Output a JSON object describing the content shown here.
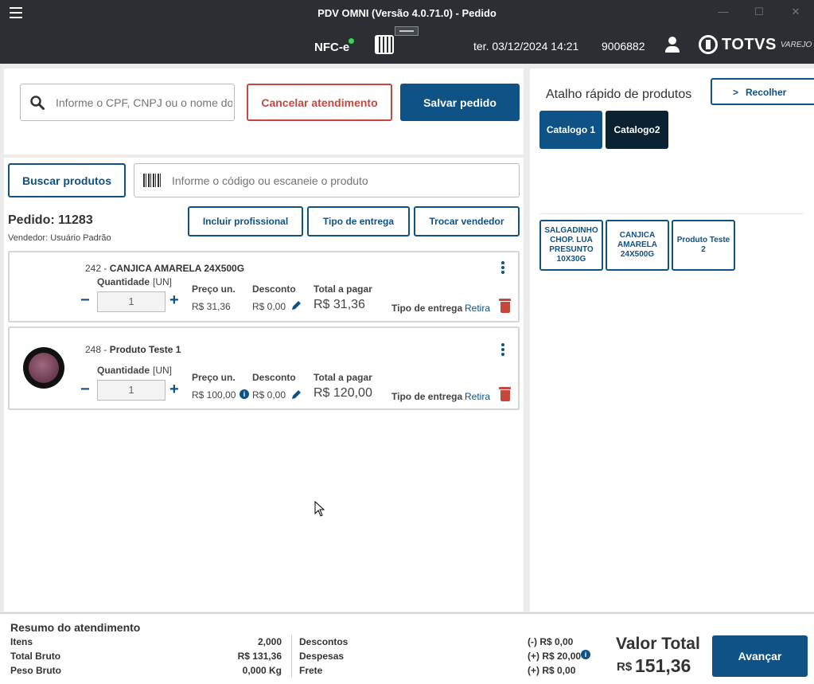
{
  "window": {
    "title": "PDV OMNI (Versão 4.0.71.0) - Pedido"
  },
  "header": {
    "nfce_label": "NFC-e",
    "datetime": "ter. 03/12/2024 14:21",
    "code": "9006882",
    "brand": "TOTVS",
    "brand_sub": "VAREJO"
  },
  "customer": {
    "search_placeholder": "Informe o CPF, CNPJ ou o nome do cliente",
    "cancel_label": "Cancelar atendimento",
    "save_label": "Salvar pedido"
  },
  "products": {
    "search_button": "Buscar produtos",
    "barcode_placeholder": "Informe o código ou escaneie o produto"
  },
  "order": {
    "title": "Pedido: 11283",
    "seller": "Vendedor: Usuário Padrão",
    "actions": [
      "Incluir profissional",
      "Tipo de entrega",
      "Trocar vendedor"
    ],
    "items": [
      {
        "code": "242 - ",
        "name": "CANJICA AMARELA 24X500G",
        "qty_label": "Quantidade",
        "unit": "[UN]",
        "qty": "1",
        "price_label": "Preço un.",
        "price": "R$ 31,36",
        "discount_label": "Desconto",
        "discount": "R$ 0,00",
        "total_label": "Total a pagar",
        "total": "R$ 31,36",
        "delivery_label": "Tipo de entrega",
        "delivery": "Retira"
      },
      {
        "code": "248 - ",
        "name": "Produto Teste 1",
        "qty_label": "Quantidade",
        "unit": "[UN]",
        "qty": "1",
        "price_label": "Preço un.",
        "price": "R$ 100,00",
        "discount_label": "Desconto",
        "discount": "R$ 0,00",
        "total_label": "Total a pagar",
        "total": "R$ 120,00",
        "delivery_label": "Tipo de entrega",
        "delivery": "Retira"
      }
    ]
  },
  "shortcuts": {
    "title": "Atalho rápido de produtos",
    "collapse_label": "Recolher",
    "catalogs": [
      "Catalogo 1",
      "Catalogo2"
    ],
    "products": [
      "SALGADINHO CHOP. LUA PRESUNTO 10X30G",
      "CANJICA AMARELA 24X500G",
      "Produto Teste 2"
    ]
  },
  "summary": {
    "title": "Resumo do atendimento",
    "itens_label": "Itens",
    "itens": "2,000",
    "bruto_label": "Total Bruto",
    "bruto": "R$ 131,36",
    "peso_label": "Peso Bruto",
    "peso": "0,000 Kg",
    "descontos_label": "Descontos",
    "descontos": "(-) R$ 0,00",
    "despesas_label": "Despesas",
    "despesas": "(+) R$ 20,00",
    "frete_label": "Frete",
    "frete": "(+) R$ 0,00",
    "total_label": "Valor Total",
    "total_currency": "R$",
    "total_value": "151,36",
    "advance_label": "Avançar"
  },
  "colors": {
    "primary": "#0e5286",
    "danger": "#c8473c",
    "dark": "#2b2f33",
    "catalog_active": "#0e5286",
    "catalog_dark": "#0b2233"
  }
}
